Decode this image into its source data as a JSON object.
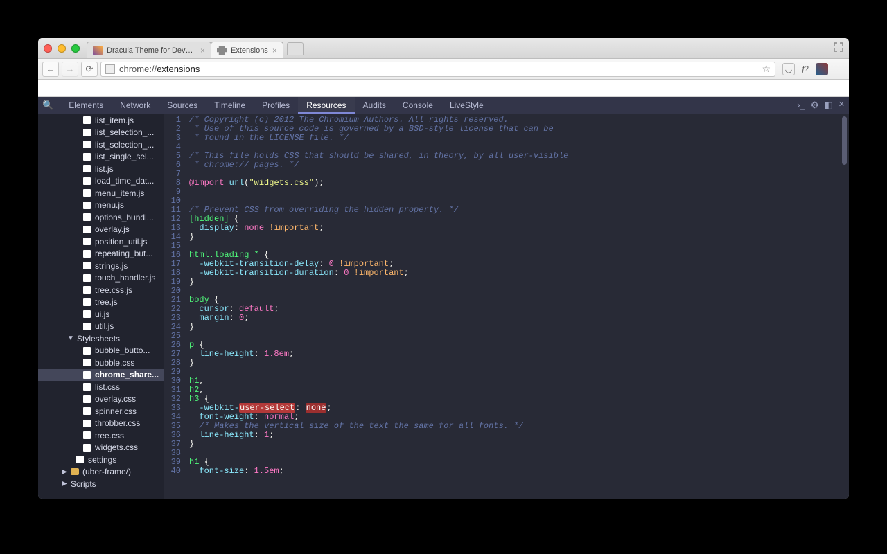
{
  "browser": {
    "tabs": [
      {
        "title": "Dracula Theme for DevToo",
        "favicon": "dracula",
        "active": false
      },
      {
        "title": "Extensions",
        "favicon": "puzzle",
        "active": true
      }
    ],
    "url_prefix": "chrome://",
    "url_path": "extensions"
  },
  "devtools": {
    "tabs": [
      "Elements",
      "Network",
      "Sources",
      "Timeline",
      "Profiles",
      "Resources",
      "Audits",
      "Console",
      "LiveStyle"
    ],
    "active_tab": "Resources"
  },
  "tree": {
    "files": [
      "list_item.js",
      "list_selection_...",
      "list_selection_...",
      "list_single_sel...",
      "list.js",
      "load_time_dat...",
      "menu_item.js",
      "menu.js",
      "options_bundl...",
      "overlay.js",
      "position_util.js",
      "repeating_but...",
      "strings.js",
      "touch_handler.js",
      "tree.css.js",
      "tree.js",
      "ui.js",
      "util.js"
    ],
    "stylesheets_label": "Stylesheets",
    "stylesheets": [
      "bubble_butto...",
      "bubble.css",
      "chrome_share...",
      "list.css",
      "overlay.css",
      "spinner.css",
      "throbber.css",
      "tree.css",
      "widgets.css"
    ],
    "selected": "chrome_share...",
    "settings_label": "settings",
    "uber_label": "(uber-frame/)",
    "scripts_label": "Scripts"
  },
  "code": {
    "lines": [
      {
        "n": 1,
        "t": "comment",
        "s": "/* Copyright (c) 2012 The Chromium Authors. All rights reserved."
      },
      {
        "n": 2,
        "t": "comment",
        "s": " * Use of this source code is governed by a BSD-style license that can be"
      },
      {
        "n": 3,
        "t": "comment",
        "s": " * found in the LICENSE file. */"
      },
      {
        "n": 4,
        "t": "blank",
        "s": ""
      },
      {
        "n": 5,
        "t": "comment",
        "s": "/* This file holds CSS that should be shared, in theory, by all user-visible"
      },
      {
        "n": 6,
        "t": "comment",
        "s": " * chrome:// pages. */"
      },
      {
        "n": 7,
        "t": "blank",
        "s": ""
      },
      {
        "n": 8,
        "t": "import",
        "kw": "@import",
        "fn": "url",
        "arg": "\"widgets.css\"",
        "tail": ";"
      },
      {
        "n": 9,
        "t": "blank",
        "s": ""
      },
      {
        "n": 10,
        "t": "blank",
        "s": ""
      },
      {
        "n": 11,
        "t": "comment",
        "s": "/* Prevent CSS from overriding the hidden property. */"
      },
      {
        "n": 12,
        "t": "selector",
        "sel": "[hidden]",
        "open": " {"
      },
      {
        "n": 13,
        "t": "decl",
        "prop": "display",
        "val": "none",
        "imp": "!important",
        "tail": ";"
      },
      {
        "n": 14,
        "t": "close",
        "s": "}"
      },
      {
        "n": 15,
        "t": "blank",
        "s": ""
      },
      {
        "n": 16,
        "t": "selector",
        "sel": "html.loading *",
        "open": " {"
      },
      {
        "n": 17,
        "t": "decl",
        "prop": "-webkit-transition-delay",
        "val": "0",
        "imp": "!important",
        "tail": ";"
      },
      {
        "n": 18,
        "t": "decl",
        "prop": "-webkit-transition-duration",
        "val": "0",
        "imp": "!important",
        "tail": ";"
      },
      {
        "n": 19,
        "t": "close",
        "s": "}"
      },
      {
        "n": 20,
        "t": "blank",
        "s": ""
      },
      {
        "n": 21,
        "t": "selector",
        "sel": "body",
        "open": " {"
      },
      {
        "n": 22,
        "t": "decl",
        "prop": "cursor",
        "val": "default",
        "tail": ";"
      },
      {
        "n": 23,
        "t": "decl",
        "prop": "margin",
        "val": "0",
        "tail": ";"
      },
      {
        "n": 24,
        "t": "close",
        "s": "}"
      },
      {
        "n": 25,
        "t": "blank",
        "s": ""
      },
      {
        "n": 26,
        "t": "selector",
        "sel": "p",
        "open": " {"
      },
      {
        "n": 27,
        "t": "decl",
        "prop": "line-height",
        "val": "1.8em",
        "tail": ";"
      },
      {
        "n": 28,
        "t": "close",
        "s": "}"
      },
      {
        "n": 29,
        "t": "blank",
        "s": ""
      },
      {
        "n": 30,
        "t": "selector",
        "sel": "h1",
        "open": ","
      },
      {
        "n": 31,
        "t": "selector",
        "sel": "h2",
        "open": ","
      },
      {
        "n": 32,
        "t": "selector",
        "sel": "h3",
        "open": " {"
      },
      {
        "n": 33,
        "t": "decl-hl",
        "prop": "-webkit-",
        "hl1": "user-select",
        "mid": ": ",
        "hl2": "none",
        "tail": ";"
      },
      {
        "n": 34,
        "t": "decl",
        "prop": "font-weight",
        "val": "normal",
        "tail": ";"
      },
      {
        "n": 35,
        "t": "comment",
        "s": "  /* Makes the vertical size of the text the same for all fonts. */"
      },
      {
        "n": 36,
        "t": "decl",
        "prop": "line-height",
        "val": "1",
        "tail": ";"
      },
      {
        "n": 37,
        "t": "close",
        "s": "}"
      },
      {
        "n": 38,
        "t": "blank",
        "s": ""
      },
      {
        "n": 39,
        "t": "selector",
        "sel": "h1",
        "open": " {"
      },
      {
        "n": 40,
        "t": "decl",
        "prop": "font-size",
        "val": "1.5em",
        "tail": ";"
      }
    ]
  }
}
